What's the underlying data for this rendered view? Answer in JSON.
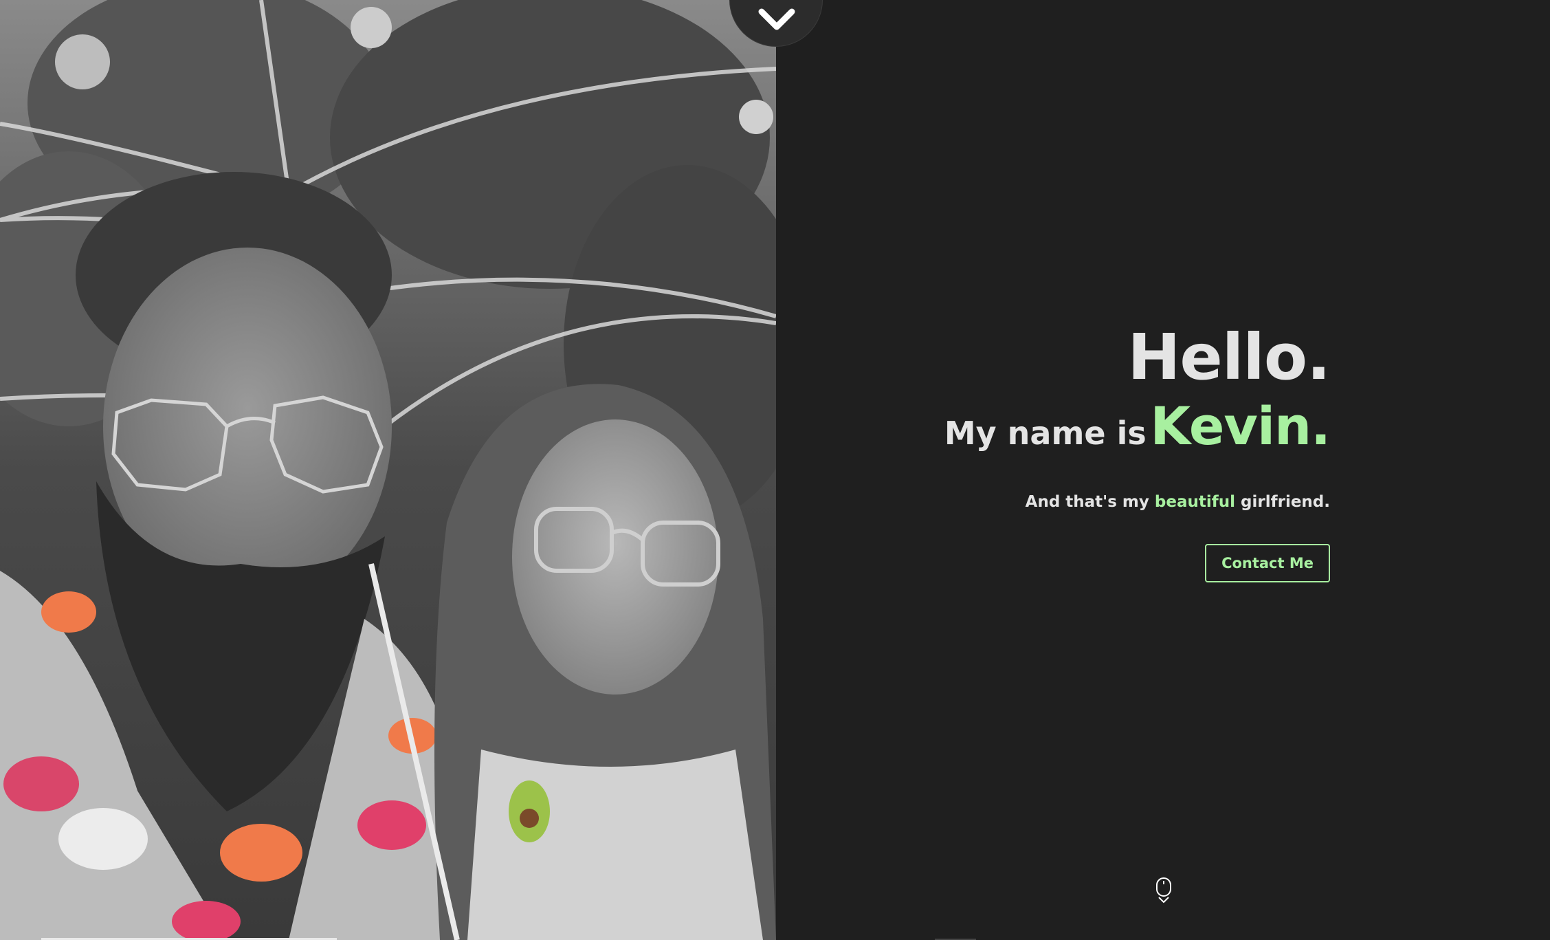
{
  "hero": {
    "greeting": "Hello.",
    "name_prefix": "My name is",
    "name": "Kevin.",
    "subline_before": "And that's my",
    "subline_highlight": "beautiful",
    "subline_after": "girlfriend.",
    "contact_label": "Contact Me"
  },
  "colors": {
    "background": "#1f1f1f",
    "accent": "#a8f0a0",
    "text": "#e4e4e4"
  },
  "icons": {
    "scroll_top": "chevron-down-icon",
    "scroll_hint": "mouse-icon"
  }
}
